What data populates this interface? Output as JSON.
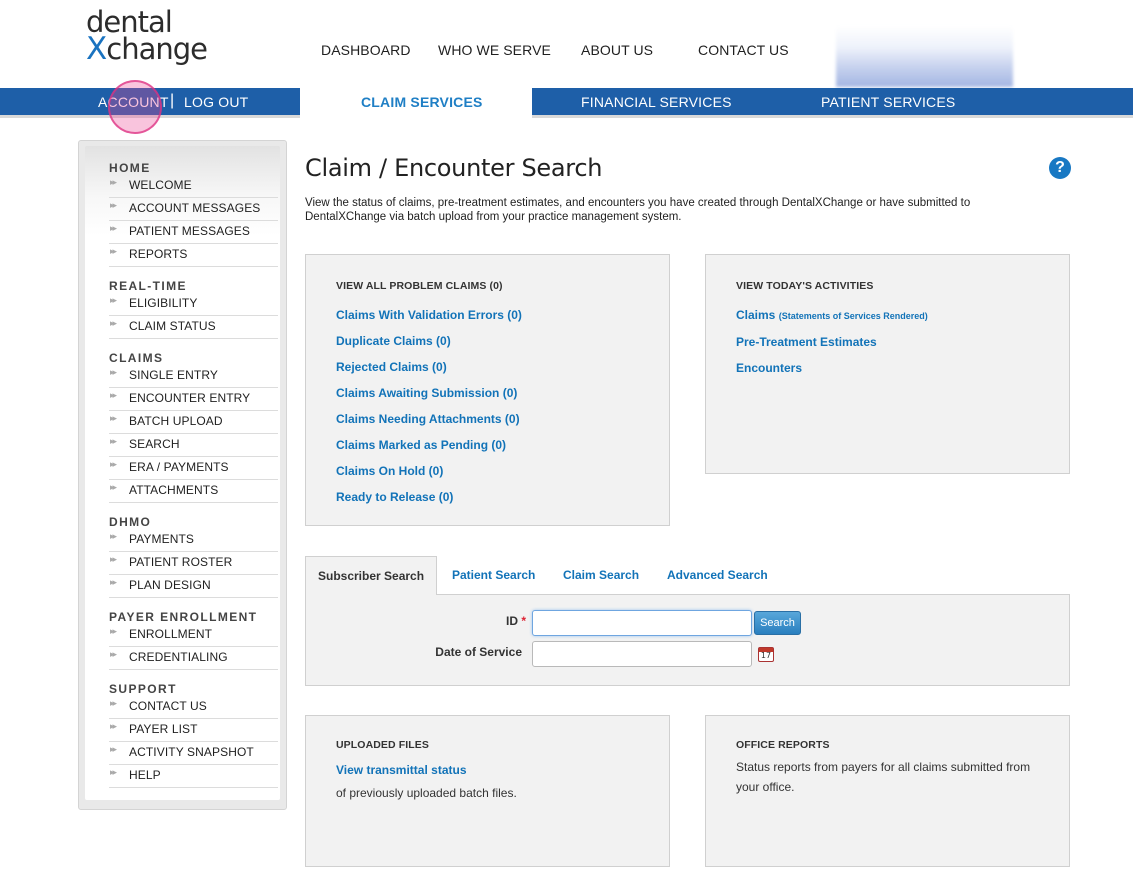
{
  "header": {
    "logo_line1": "dental",
    "logo_x": "X",
    "logo_rest": "change",
    "top_nav": [
      "DASHBOARD",
      "WHO WE SERVE",
      "ABOUT US",
      "CONTACT US"
    ]
  },
  "bluebar": {
    "account": "ACCOUNT",
    "separator": "|",
    "logout": "LOG OUT",
    "tabs": [
      "CLAIM SERVICES",
      "FINANCIAL SERVICES",
      "PATIENT SERVICES"
    ],
    "active_tab": "CLAIM SERVICES"
  },
  "sidebar": {
    "sections": [
      {
        "title": "HOME",
        "items": [
          "WELCOME",
          "ACCOUNT MESSAGES",
          "PATIENT MESSAGES",
          "REPORTS"
        ]
      },
      {
        "title": "REAL-TIME",
        "items": [
          "ELIGIBILITY",
          "CLAIM STATUS"
        ]
      },
      {
        "title": "CLAIMS",
        "items": [
          "SINGLE ENTRY",
          "ENCOUNTER ENTRY",
          "BATCH UPLOAD",
          "SEARCH",
          "ERA / PAYMENTS",
          "ATTACHMENTS"
        ]
      },
      {
        "title": "DHMO",
        "items": [
          "PAYMENTS",
          "PATIENT ROSTER",
          "PLAN DESIGN"
        ]
      },
      {
        "title": "PAYER ENROLLMENT",
        "items": [
          "ENROLLMENT",
          "CREDENTIALING"
        ]
      },
      {
        "title": "SUPPORT",
        "items": [
          "CONTACT US",
          "PAYER LIST",
          "ACTIVITY SNAPSHOT",
          "HELP"
        ]
      }
    ],
    "arrow": "▸▸"
  },
  "main": {
    "title": "Claim / Encounter Search",
    "help": "?",
    "intro": "View the status of claims, pre-treatment estimates, and encounters you have created through DentalXChange or have submitted to DentalXChange via batch upload from your practice management system.",
    "problem_claims": {
      "title": "VIEW ALL PROBLEM CLAIMS (0)",
      "links": [
        "Claims With Validation Errors (0)",
        "Duplicate Claims (0)",
        "Rejected Claims (0)",
        "Claims Awaiting Submission (0)",
        "Claims Needing Attachments (0)",
        "Claims Marked as Pending (0)",
        "Claims On Hold (0)",
        "Ready to Release (0)"
      ]
    },
    "today": {
      "title": "VIEW TODAY'S ACTIVITIES",
      "claims": "Claims",
      "claims_note": "(Statements of Services Rendered)",
      "pte": "Pre-Treatment Estimates",
      "encounters": "Encounters"
    },
    "search": {
      "tabs": [
        "Subscriber Search",
        "Patient Search",
        "Claim Search",
        "Advanced Search"
      ],
      "active_tab": "Subscriber Search",
      "id_label": "ID",
      "required_mark": "*",
      "id_value": "",
      "dos_label": "Date of Service",
      "dos_value": "",
      "button": "Search",
      "calendar_day": "17"
    },
    "uploaded": {
      "title": "UPLOADED FILES",
      "link": "View transmittal status",
      "text": "of previously uploaded batch files."
    },
    "office": {
      "title": "OFFICE REPORTS",
      "text": "Status reports from payers for all claims submitted from your office."
    }
  },
  "colors": {
    "brand_blue": "#1e5fa8",
    "link_blue": "#1273b8",
    "panel_bg": "#f2f2f2"
  }
}
